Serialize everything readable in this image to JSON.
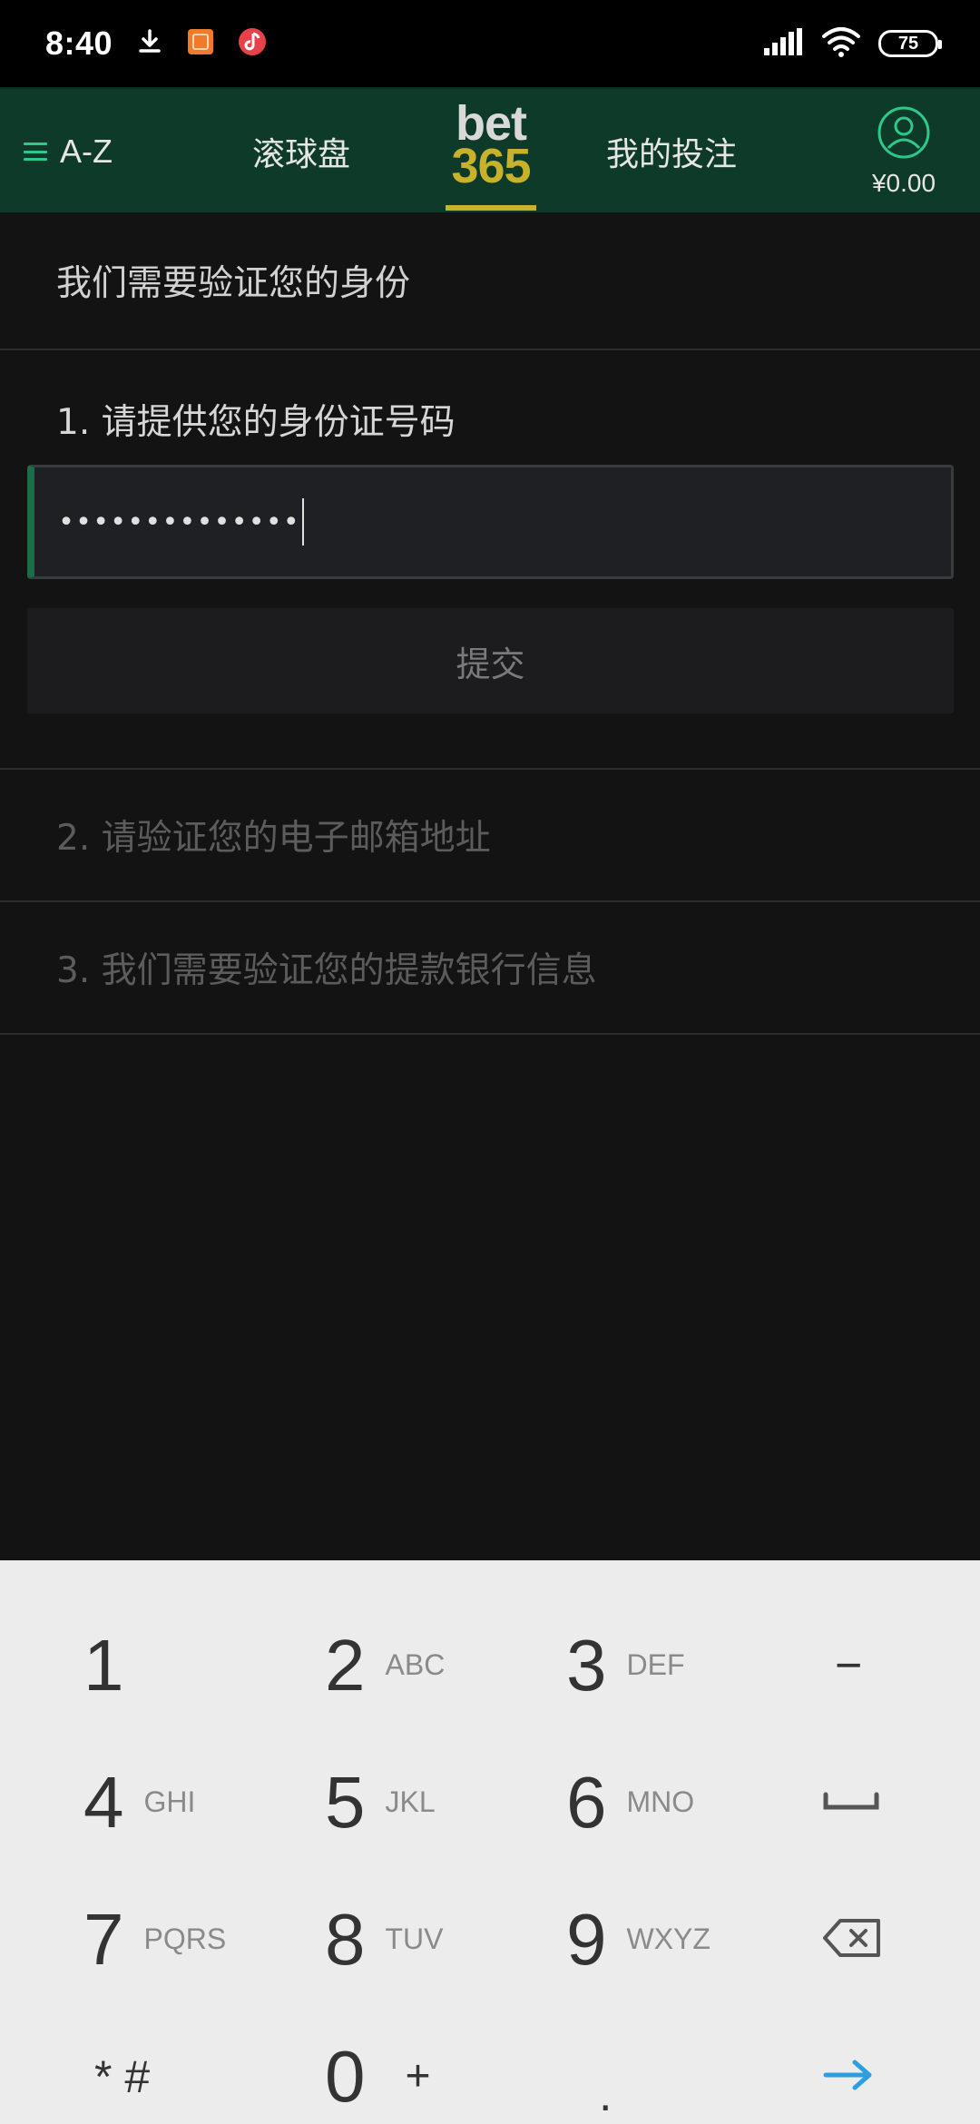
{
  "status_bar": {
    "time": "8:40",
    "battery": "75",
    "icons": [
      "download-icon",
      "app-notification-icon",
      "music-icon",
      "signal-icon",
      "wifi-icon",
      "battery-icon"
    ]
  },
  "header": {
    "menu_label": "A-Z",
    "inplay_label": "滚球盘",
    "logo_top": "bet",
    "logo_bottom": "365",
    "mybets_label": "我的投注",
    "balance": "¥0.00",
    "colors": {
      "header_bg": "#0e3a2a",
      "accent": "#2ec98a",
      "brand_gold": "#c8b22a"
    }
  },
  "verification": {
    "title": "我们需要验证您的身份",
    "step1": {
      "label": "1. 请提供您的身份证号码",
      "input_value": "••••••••••••••",
      "submit_label": "提交"
    },
    "step2_label": "2. 请验证您的电子邮箱地址",
    "step3_label": "3. 我们需要验证您的提款银行信息"
  },
  "keyboard": {
    "keys": [
      {
        "num": "1",
        "letters": ""
      },
      {
        "num": "2",
        "letters": "ABC"
      },
      {
        "num": "3",
        "letters": "DEF"
      },
      {
        "num": "4",
        "letters": "GHI"
      },
      {
        "num": "5",
        "letters": "JKL"
      },
      {
        "num": "6",
        "letters": "MNO"
      },
      {
        "num": "7",
        "letters": "PQRS"
      },
      {
        "num": "8",
        "letters": "TUV"
      },
      {
        "num": "9",
        "letters": "WXYZ"
      },
      {
        "num": "0",
        "letters": "+"
      }
    ],
    "minus": "−",
    "star_hash": "* #",
    "dot": ".",
    "space_icon": "space-icon",
    "backspace_icon": "backspace-icon",
    "enter_icon": "arrow-right-icon",
    "enter_color": "#2d9ee0"
  }
}
